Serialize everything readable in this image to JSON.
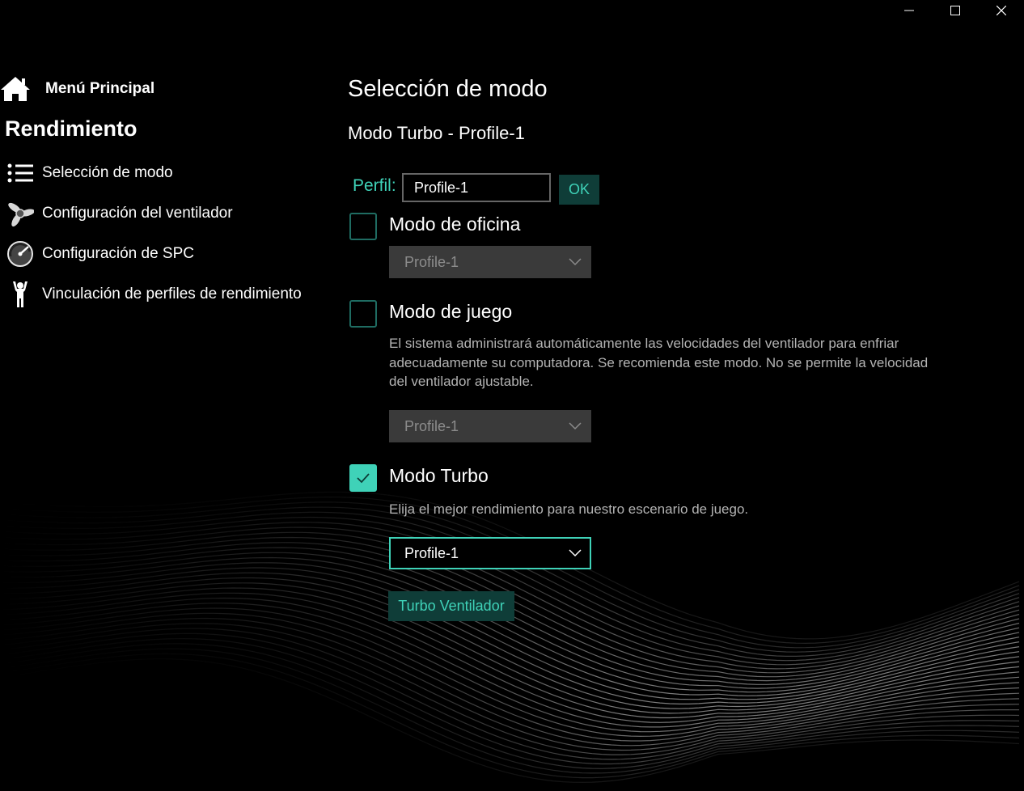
{
  "window": {
    "minimize_icon": "minimize-icon",
    "maximize_icon": "maximize-icon",
    "close_icon": "close-icon"
  },
  "sidebar": {
    "home_label": "Menú Principal",
    "section_title": "Rendimiento",
    "items": [
      {
        "label": "Selección de modo",
        "icon": "list-icon"
      },
      {
        "label": "Configuración del ventilador",
        "icon": "fan-icon"
      },
      {
        "label": "Configuración de SPC",
        "icon": "gauge-icon"
      },
      {
        "label": "Vinculación de perfiles de rendimiento",
        "icon": "person-icon"
      }
    ]
  },
  "main": {
    "title": "Selección de modo",
    "subtitle": "Modo Turbo - Profile-1",
    "profile": {
      "label": "Perfil:",
      "value": "Profile-1",
      "ok_label": "OK"
    },
    "modes": [
      {
        "label": "Modo de oficina",
        "checked": false,
        "description": "",
        "select_value": "Profile-1",
        "enabled": false
      },
      {
        "label": "Modo de juego",
        "checked": false,
        "description": "El sistema administrará automáticamente las velocidades del ventilador para enfriar adecuadamente su computadora. Se recomienda este modo. No se permite la velocidad del ventilador ajustable.",
        "select_value": "Profile-1",
        "enabled": false
      },
      {
        "label": "Modo Turbo",
        "checked": true,
        "description": "Elija el mejor rendimiento para nuestro escenario de juego.",
        "select_value": "Profile-1",
        "enabled": true
      }
    ],
    "turbo_fan_label": "Turbo Ventilador"
  },
  "colors": {
    "accent": "#3fd2b8",
    "accent_dark": "#0f3d38",
    "checkbox_border": "#1f6c62",
    "disabled_select": "#3a3a3a"
  }
}
